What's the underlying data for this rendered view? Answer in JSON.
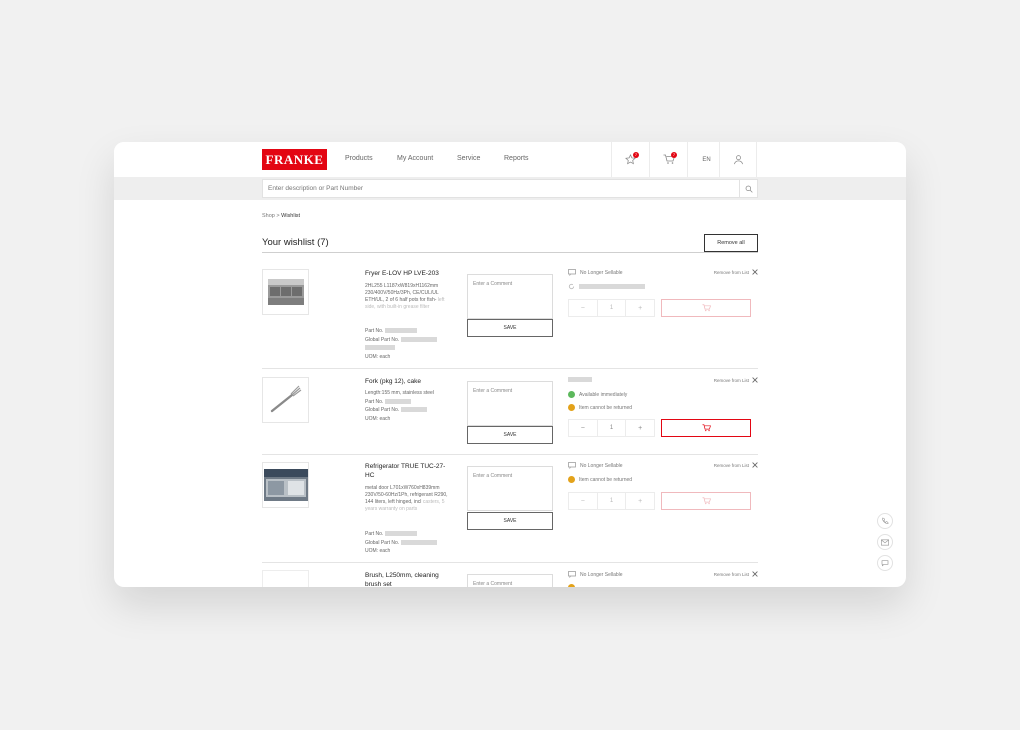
{
  "header": {
    "logo_text": "FRANKE",
    "nav": [
      "Products",
      "My Account",
      "Service",
      "Reports"
    ],
    "wishlist_badge": "7",
    "cart_badge": "7",
    "language": "EN"
  },
  "search": {
    "placeholder": "Enter description or Part Number"
  },
  "breadcrumb": {
    "root": "Shop",
    "separator": ">",
    "current": "Wishlist"
  },
  "page": {
    "title": "Your wishlist (7)",
    "remove_all": "Remove all"
  },
  "labels": {
    "comment_placeholder": "Enter a Comment",
    "save": "SAVE",
    "remove_from_list": "Remove from List",
    "part_no": "Part No.",
    "global_part_no": "Global Part No.",
    "uom": "UOM: each"
  },
  "items": [
    {
      "name": "Fryer E-LOV HP LVE-203",
      "desc": "2HL255 L1187xW819xH1162mm 230/400V/50Hz/3Ph, CE/CUL/UL ETH/UL, 2 of 6 half pots for fish-",
      "desc_fade": "left side, with built-in grease filter",
      "status1": "No Longer Sellable",
      "quantity": "1"
    },
    {
      "name": "Fork (pkg 12), cake",
      "desc": "Length:155 mm, stainless steel",
      "status1": "Available immediately",
      "status2": "Item cannot be returned",
      "quantity": "1"
    },
    {
      "name": "Refrigerator TRUE TUC-27-HC",
      "desc": "metal door L701xW760xH839mm 230V/50-60Hz/1Ph, refrigerant R290, 144 liters, left hinged, incl",
      "desc_fade": "casters, 5 years warranty on parts",
      "status1": "No Longer Sellable",
      "status2": "Item cannot be returned",
      "quantity": "1"
    },
    {
      "name": "Brush, L250mm, cleaning brush set",
      "status1": "No Longer Sellable"
    }
  ],
  "colors": {
    "brand": "#e30613",
    "success": "#5cb85c",
    "warning": "#e3a21a"
  }
}
